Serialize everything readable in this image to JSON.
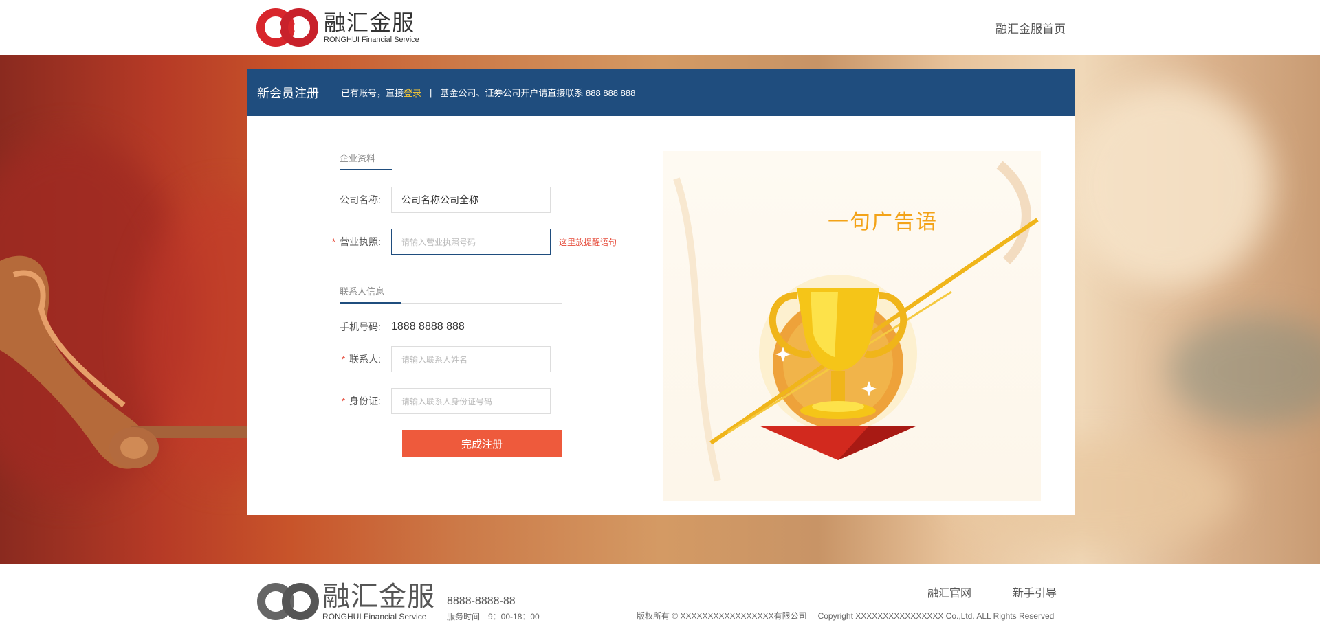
{
  "header": {
    "logo_cn": "融汇金服",
    "logo_en": "RONGHUI Financial Service",
    "home_link": "融汇金服首页"
  },
  "card": {
    "title": "新会员注册",
    "have_account": "已有账号，直接",
    "login": "登录",
    "separator": "|",
    "contact_note": "基金公司、证券公司开户请直接联系 888 888 888"
  },
  "form": {
    "section_company": "企业资料",
    "company_name_label": "公司名称:",
    "company_name_value": "公司名称公司全称",
    "license_label": "营业执照:",
    "license_placeholder": "请输入营业执照号码",
    "license_hint": "这里放提醒语句",
    "section_contact": "联系人信息",
    "phone_label": "手机号码:",
    "phone_value": "1888 8888 888",
    "contact_label": "联系人:",
    "contact_placeholder": "请输入联系人姓名",
    "id_label": "身份证:",
    "id_placeholder": "请输入联系人身份证号码",
    "required_mark": "*",
    "submit": "完成注册"
  },
  "ad": {
    "slogan": "一句广告语"
  },
  "footer": {
    "logo_cn": "融汇金服",
    "logo_en": "RONGHUI Financial Service",
    "phone": "8888-8888-88",
    "hours": "服务时间　9：00-18：00",
    "link_official": "融汇官网",
    "link_guide": "新手引导",
    "copyright_cn": "版权所有 © XXXXXXXXXXXXXXXXX有限公司",
    "copyright_en": "Copyright XXXXXXXXXXXXXXXX Co.,Ltd. ALL Rights Reserved"
  },
  "colors": {
    "brand_blue": "#1f4d7e",
    "submit_orange": "#ee5a3c",
    "login_yellow": "#ffcc33",
    "hint_red": "#e64b3a",
    "slogan_gold": "#f3a318",
    "logo_red": "#d8262c"
  }
}
